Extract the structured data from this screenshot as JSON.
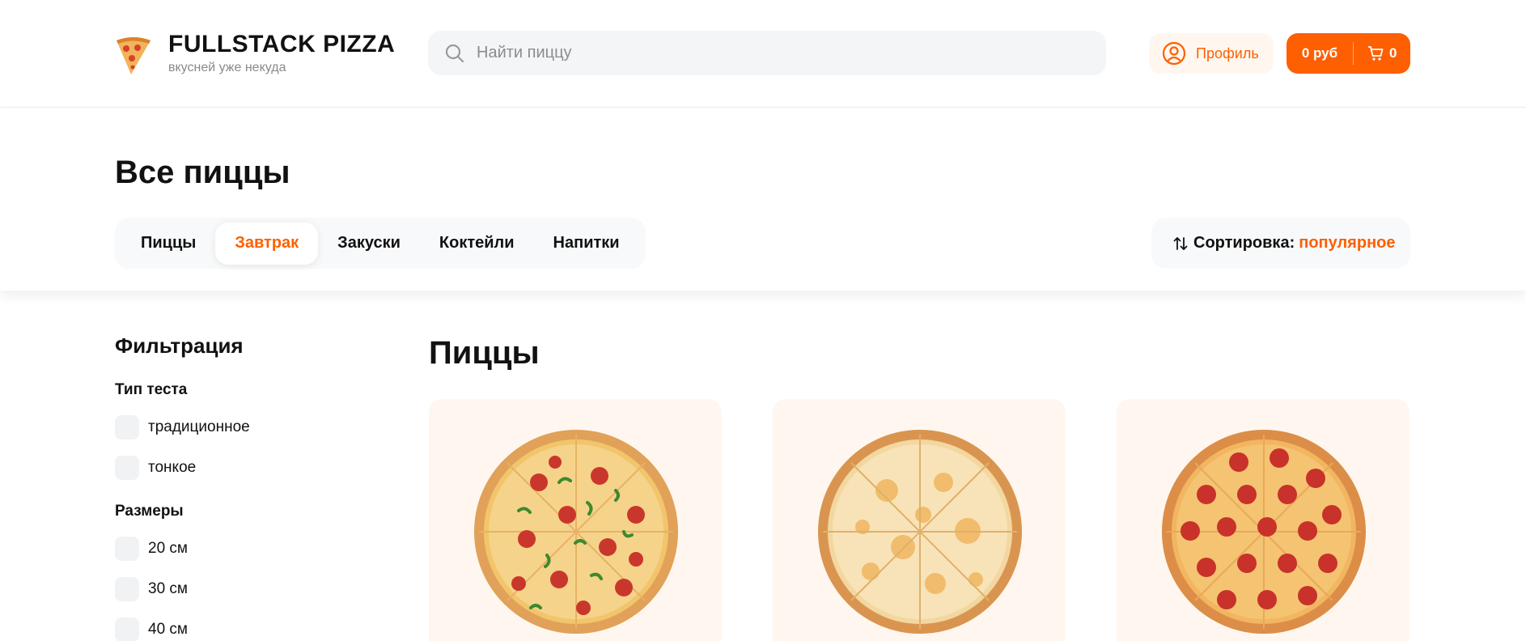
{
  "header": {
    "logo_title": "FULLSTACK PIZZA",
    "logo_subtitle": "вкусней уже некуда",
    "search_placeholder": "Найти пиццу",
    "profile_label": "Профиль",
    "cart_sum": "0 руб",
    "cart_count": "0"
  },
  "topbar": {
    "title": "Все пиццы",
    "categories": [
      {
        "label": "Пиццы",
        "active": false
      },
      {
        "label": "Завтрак",
        "active": true
      },
      {
        "label": "Закуски",
        "active": false
      },
      {
        "label": "Коктейли",
        "active": false
      },
      {
        "label": "Напитки",
        "active": false
      }
    ],
    "sort_label": "Сортировка:",
    "sort_value": "популярное"
  },
  "filters": {
    "title": "Фильтрация",
    "dough_title": "Тип теста",
    "dough_options": [
      "традиционное",
      "тонкое"
    ],
    "sizes_title": "Размеры",
    "size_options": [
      "20 см",
      "30 см",
      "40 см"
    ]
  },
  "products": {
    "section_title": "Пиццы",
    "items": [
      {
        "image": "pizza-pepperoni-peppers"
      },
      {
        "image": "pizza-cheese"
      },
      {
        "image": "pizza-pepperoni"
      }
    ]
  },
  "colors": {
    "accent": "#fe5f00",
    "accent_soft": "#fff7ef",
    "surface": "#f8f9fa"
  }
}
